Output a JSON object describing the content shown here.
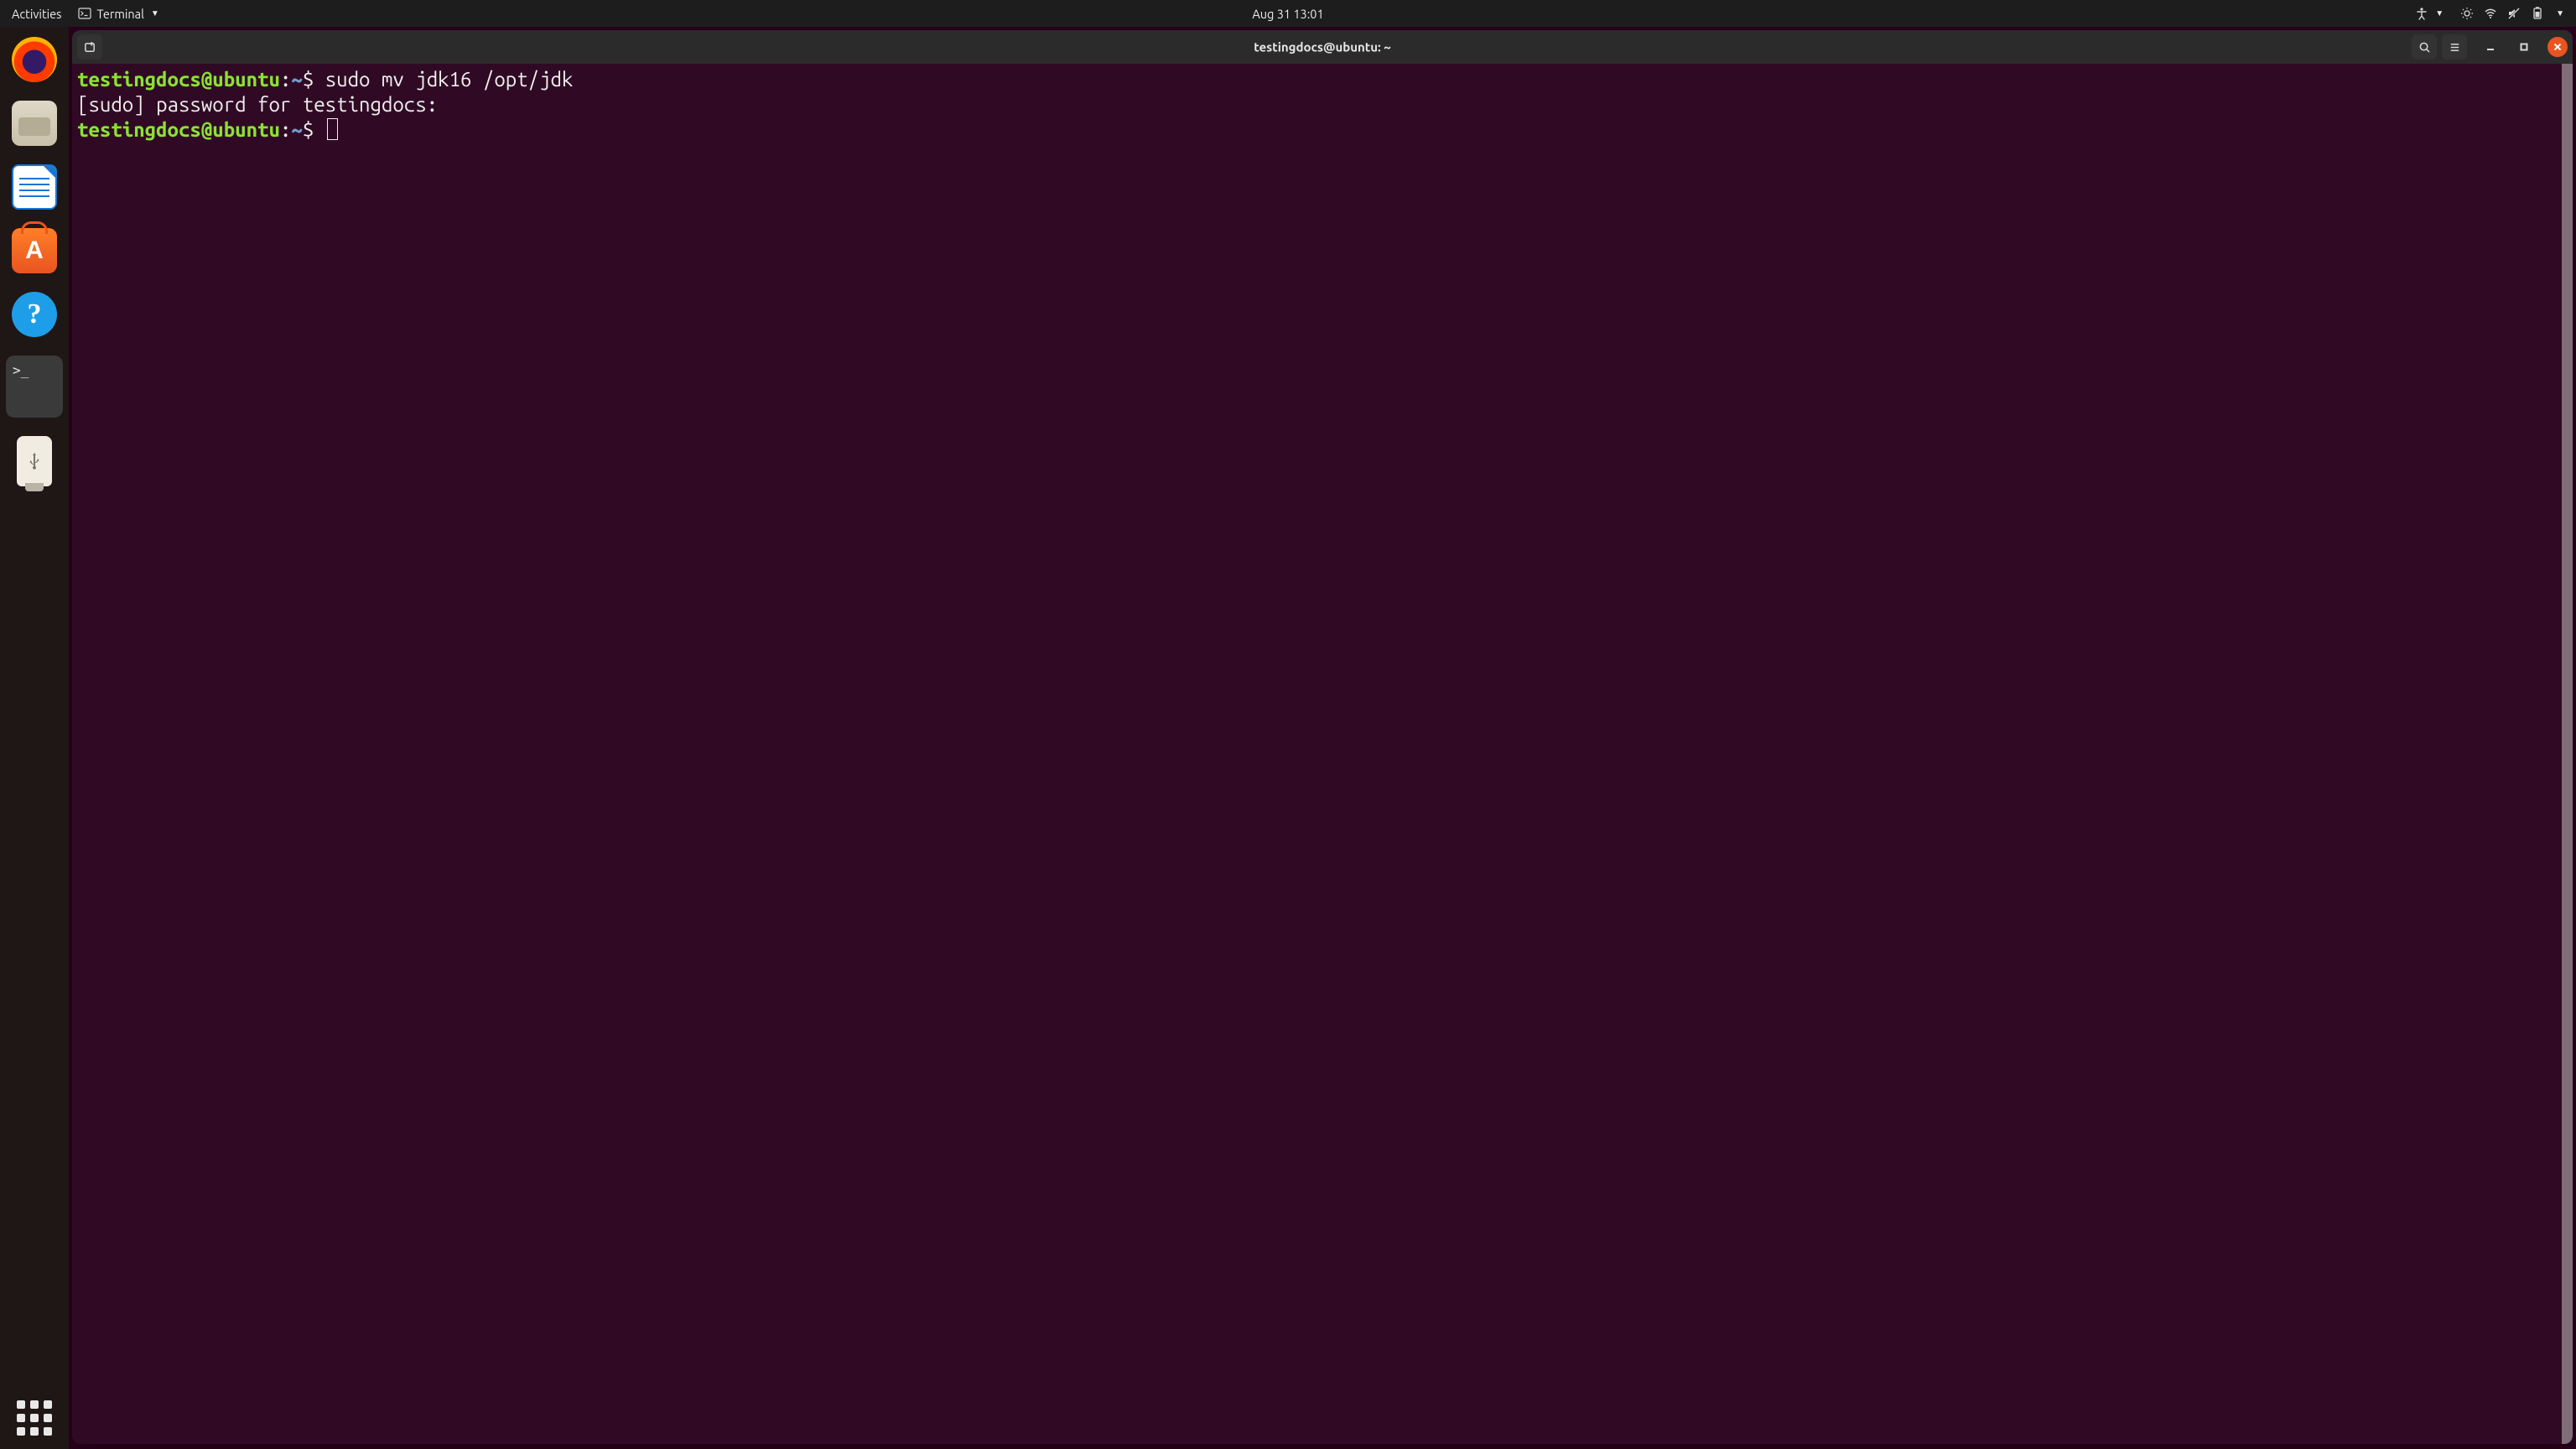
{
  "topbar": {
    "activities": "Activities",
    "app_name": "Terminal",
    "clock": "Aug 31  13:01"
  },
  "dock": {
    "firefox": "Firefox",
    "files": "Files",
    "writer": "LibreOffice Writer",
    "software": "Ubuntu Software",
    "software_glyph": "A",
    "help": "Help",
    "help_glyph": "?",
    "terminal": "Terminal",
    "terminal_glyph": ">_",
    "usb": "Removable Drive",
    "show_apps": "Show Applications"
  },
  "window": {
    "title": "testingdocs@ubuntu: ~"
  },
  "terminal": {
    "prompt_user": "testingdocs@ubuntu",
    "prompt_sep": ":",
    "prompt_path": "~",
    "prompt_sigil": "$",
    "cmd1": "sudo mv jdk16 /opt/jdk",
    "line2": "[sudo] password for testingdocs:",
    "space": " "
  }
}
